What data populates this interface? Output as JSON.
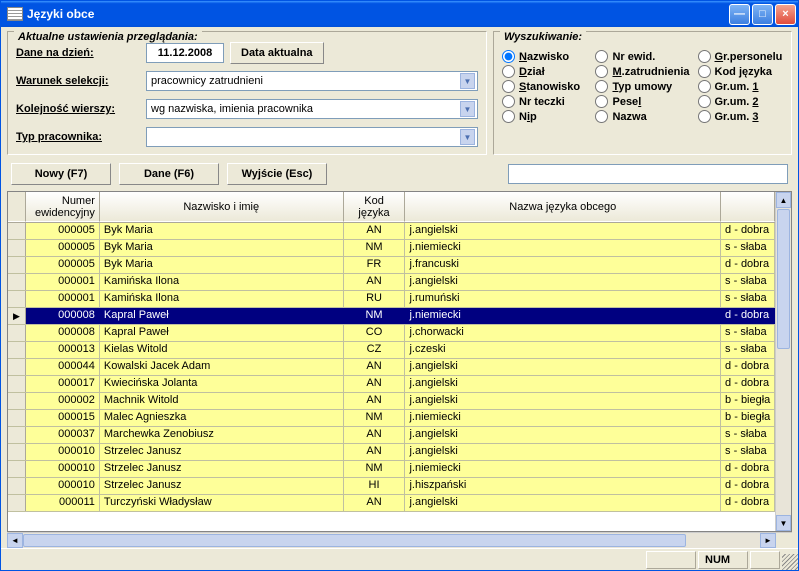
{
  "window": {
    "title": "Języki obce"
  },
  "settings": {
    "panel_title": "Aktualne ustawienia przeglądania:",
    "date_label": "Dane na dzień:",
    "date_value": "11.12.2008",
    "date_button": "Data aktualna",
    "selection_label": "Warunek selekcji:",
    "selection_value": "pracownicy zatrudnieni",
    "order_label": "Kolejność wierszy:",
    "order_value": "wg nazwiska, imienia pracownika",
    "type_label": "Typ pracownika:",
    "type_value": ""
  },
  "search": {
    "panel_title": "Wyszukiwanie:",
    "options": [
      {
        "label": "Nazwisko",
        "u": "N",
        "rest": "azwisko",
        "checked": true
      },
      {
        "label": "Nr ewid.",
        "u": "",
        "rest": "Nr ewid.",
        "checked": false
      },
      {
        "label": "Gr.personelu",
        "u": "G",
        "rest": "r.personelu",
        "checked": false
      },
      {
        "label": "Dział",
        "u": "D",
        "rest": "ział",
        "checked": false
      },
      {
        "label": "M.zatrudnienia",
        "u": "M",
        "rest": ".zatrudnienia",
        "checked": false
      },
      {
        "label": "Kod języka",
        "u": "",
        "rest": "Kod języka",
        "checked": false
      },
      {
        "label": "Stanowisko",
        "u": "S",
        "rest": "tanowisko",
        "checked": false
      },
      {
        "label": "Typ umowy",
        "u": "T",
        "rest": "yp umowy",
        "checked": false
      },
      {
        "label": "Gr.um. 1",
        "u": "1",
        "rest_before": "Gr.um. ",
        "checked": false
      },
      {
        "label": "Nr teczki",
        "u": "",
        "rest": "Nr teczki",
        "checked": false
      },
      {
        "label": "Pesel",
        "u": "l",
        "rest_before": "Pese",
        "checked": false
      },
      {
        "label": "Gr.um. 2",
        "u": "2",
        "rest_before": "Gr.um. ",
        "checked": false
      },
      {
        "label": "Nip",
        "u": "i",
        "rest_before": "N",
        "rest_after": "p",
        "checked": false
      },
      {
        "label": "Nazwa",
        "u": "",
        "rest": "Nazwa",
        "checked": false
      },
      {
        "label": "Gr.um. 3",
        "u": "3",
        "rest_before": "Gr.um. ",
        "checked": false
      }
    ],
    "field_value": ""
  },
  "buttons": {
    "new": "Nowy (F7)",
    "data": "Dane (F6)",
    "exit": "Wyjście (Esc)"
  },
  "grid": {
    "headers": {
      "col1": "Numer ewidencyjny",
      "col2": "Nazwisko i imię",
      "col3": "Kod języka",
      "col4": "Nazwa języka obcego",
      "col5": ""
    },
    "rows": [
      {
        "id": "000005",
        "name": "Byk Maria",
        "code": "AN",
        "lang": "j.angielski",
        "level": "d - dobra",
        "selected": false
      },
      {
        "id": "000005",
        "name": "Byk Maria",
        "code": "NM",
        "lang": "j.niemiecki",
        "level": "s - słaba",
        "selected": false
      },
      {
        "id": "000005",
        "name": "Byk Maria",
        "code": "FR",
        "lang": "j.francuski",
        "level": "d - dobra",
        "selected": false
      },
      {
        "id": "000001",
        "name": "Kamińska Ilona",
        "code": "AN",
        "lang": "j.angielski",
        "level": "s - słaba",
        "selected": false
      },
      {
        "id": "000001",
        "name": "Kamińska Ilona",
        "code": "RU",
        "lang": "j.rumuński",
        "level": "s - słaba",
        "selected": false
      },
      {
        "id": "000008",
        "name": "Kapral Paweł",
        "code": "NM",
        "lang": "j.niemiecki",
        "level": "d - dobra",
        "selected": true
      },
      {
        "id": "000008",
        "name": "Kapral Paweł",
        "code": "CO",
        "lang": "j.chorwacki",
        "level": "s - słaba",
        "selected": false
      },
      {
        "id": "000013",
        "name": "Kielas Witold",
        "code": "CZ",
        "lang": "j.czeski",
        "level": "s - słaba",
        "selected": false
      },
      {
        "id": "000044",
        "name": "Kowalski Jacek Adam",
        "code": "AN",
        "lang": "j.angielski",
        "level": "d - dobra",
        "selected": false
      },
      {
        "id": "000017",
        "name": "Kwiecińska Jolanta",
        "code": "AN",
        "lang": "j.angielski",
        "level": "d - dobra",
        "selected": false
      },
      {
        "id": "000002",
        "name": "Machnik Witold",
        "code": "AN",
        "lang": "j.angielski",
        "level": "b - biegła",
        "selected": false
      },
      {
        "id": "000015",
        "name": "Malec Agnieszka",
        "code": "NM",
        "lang": "j.niemiecki",
        "level": "b - biegła",
        "selected": false
      },
      {
        "id": "000037",
        "name": "Marchewka Zenobiusz",
        "code": "AN",
        "lang": "j.angielski",
        "level": "s - słaba",
        "selected": false
      },
      {
        "id": "000010",
        "name": "Strzelec Janusz",
        "code": "AN",
        "lang": "j.angielski",
        "level": "s - słaba",
        "selected": false
      },
      {
        "id": "000010",
        "name": "Strzelec Janusz",
        "code": "NM",
        "lang": "j.niemiecki",
        "level": "d - dobra",
        "selected": false
      },
      {
        "id": "000010",
        "name": "Strzelec Janusz",
        "code": "HI",
        "lang": "j.hiszpański",
        "level": "d - dobra",
        "selected": false
      },
      {
        "id": "000011",
        "name": "Turczyński Władysław",
        "code": "AN",
        "lang": "j.angielski",
        "level": "d - dobra",
        "selected": false
      }
    ]
  },
  "statusbar": {
    "num": "NUM"
  }
}
